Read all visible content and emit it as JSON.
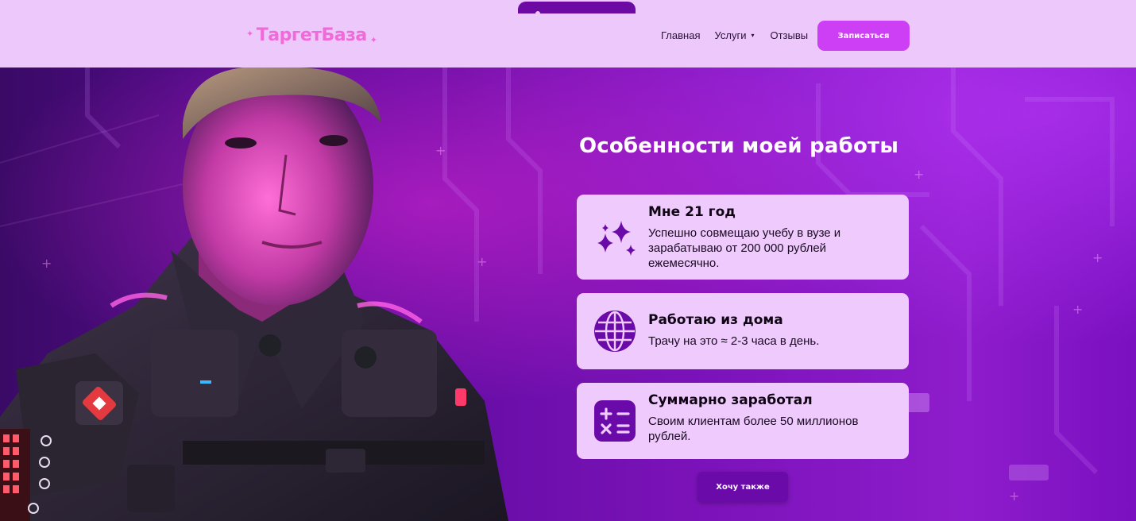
{
  "header": {
    "logo_text": "ТаргетБаза",
    "nav": [
      {
        "label": "Главная"
      },
      {
        "label": "Услуги"
      },
      {
        "label": "Отзывы"
      }
    ],
    "signup_label": "Записаться"
  },
  "hero": {
    "title": "Особенности моей работы",
    "cards": [
      {
        "title": "Мне 21 год",
        "text": "Успешно совмещаю учебу в вузе и зарабатываю от 200 000 рублей ежемесячно.",
        "icon": "sparkles-icon"
      },
      {
        "title": "Работаю из дома",
        "text": "Трачу на это ≈ 2-3 часа в день.",
        "icon": "globe-icon"
      },
      {
        "title": "Суммарно заработал",
        "text": "Своим клиентам более 50 миллионов рублей.",
        "icon": "calculator-icon"
      }
    ],
    "cta_label": "Хочу также"
  },
  "colors": {
    "header_bg": "#ecc8fb",
    "accent_pink": "#cd3ff5",
    "logo_pink": "#f06ad9",
    "deep_purple": "#6a0aa8",
    "card_bg": "#efcafc"
  }
}
